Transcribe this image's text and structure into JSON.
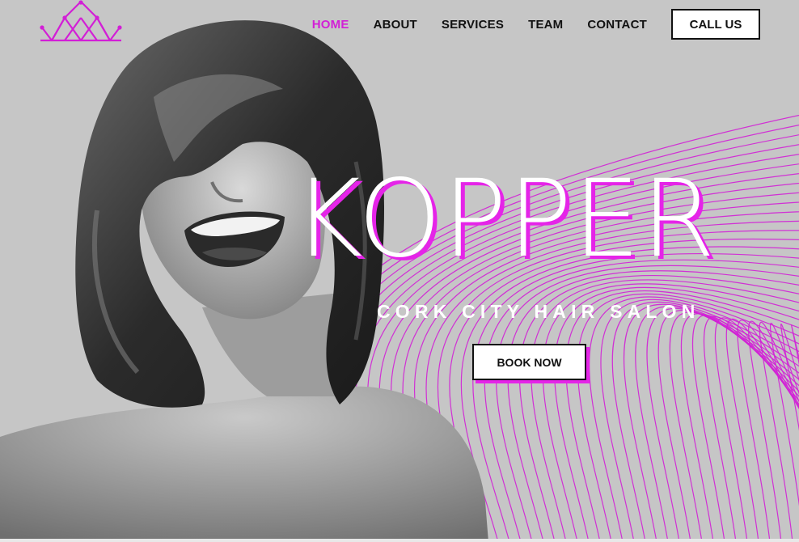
{
  "brand": {
    "accent_color": "#d21fd6",
    "logo_icon": "crown-icon"
  },
  "nav": {
    "items": [
      {
        "label": "HOME",
        "active": true
      },
      {
        "label": "ABOUT",
        "active": false
      },
      {
        "label": "SERVICES",
        "active": false
      },
      {
        "label": "TEAM",
        "active": false
      },
      {
        "label": "CONTACT",
        "active": false
      }
    ],
    "call_label": "CALL US"
  },
  "hero": {
    "title": "KOPPER",
    "subtitle": "CORK CITY HAIR SALON",
    "cta_label": "BOOK NOW",
    "background_color": "#c6c6c6",
    "line_color": "#d21fd6"
  }
}
